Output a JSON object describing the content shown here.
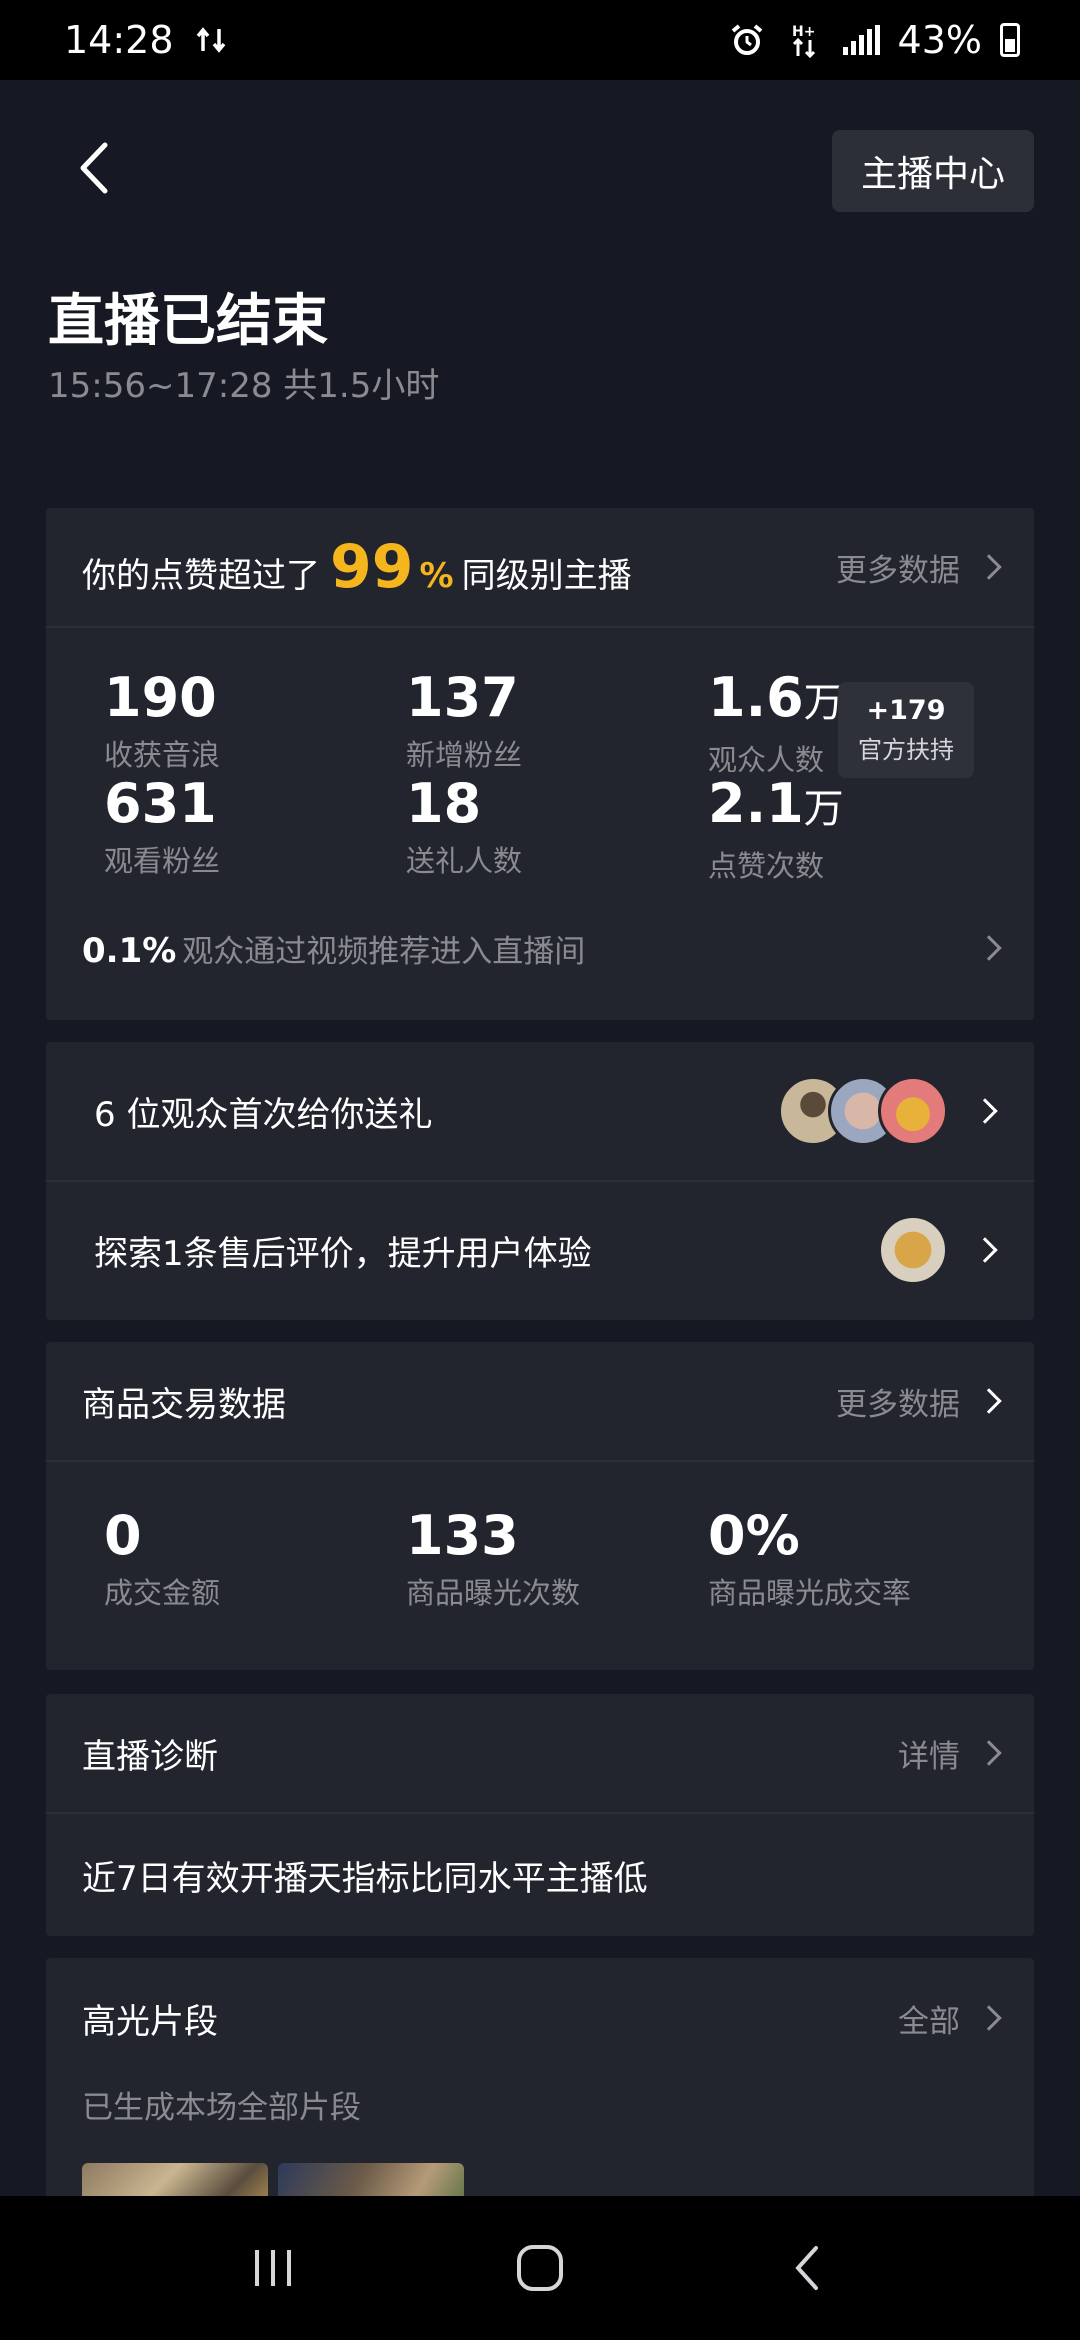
{
  "status_bar": {
    "time": "14:28",
    "battery": "43%",
    "icons": [
      "data-transfer-icon",
      "alarm-icon",
      "network-icon",
      "signal-icon",
      "battery-icon"
    ]
  },
  "header": {
    "back_icon": "chevron-left-icon",
    "anchor_center_label": "主播中心",
    "title": "直播已结束",
    "subtitle": "15:56~17:28 共1.5小时"
  },
  "likes_card": {
    "prefix": "你的点赞超过了",
    "percent": "99",
    "percent_sign": "%",
    "suffix": "同级别主播",
    "more_label": "更多数据",
    "stats": [
      {
        "value": "190",
        "unit": "",
        "label": "收获音浪"
      },
      {
        "value": "137",
        "unit": "",
        "label": "新增粉丝"
      },
      {
        "value": "1.6",
        "unit": "万",
        "label": "观众人数"
      },
      {
        "value": "631",
        "unit": "",
        "label": "观看粉丝"
      },
      {
        "value": "18",
        "unit": "",
        "label": "送礼人数"
      },
      {
        "value": "2.1",
        "unit": "万",
        "label": "点赞次数"
      }
    ],
    "boost": {
      "value": "+179",
      "label": "官方扶持"
    },
    "footer_pct": "0.1%",
    "footer_text": "观众通过视频推荐进入直播间"
  },
  "notices": [
    {
      "text": "6 位观众首次给你送礼"
    },
    {
      "text": "探索1条售后评价，提升用户体验"
    }
  ],
  "trade_card": {
    "title": "商品交易数据",
    "more_label": "更多数据",
    "stats": [
      {
        "value": "0",
        "label": "成交金额"
      },
      {
        "value": "133",
        "label": "商品曝光次数"
      },
      {
        "value": "0%",
        "label": "商品曝光成交率"
      }
    ]
  },
  "diagnosis_card": {
    "title": "直播诊断",
    "more_label": "详情",
    "body": "近7日有效开播天指标比同水平主播低"
  },
  "highlights_card": {
    "title": "高光片段",
    "more_label": "全部",
    "subtitle": "已生成本场全部片段"
  },
  "colors": {
    "background": "#161823",
    "card": "#22242e",
    "accent": "#f5b61d",
    "muted_text": "#8a8b91"
  }
}
